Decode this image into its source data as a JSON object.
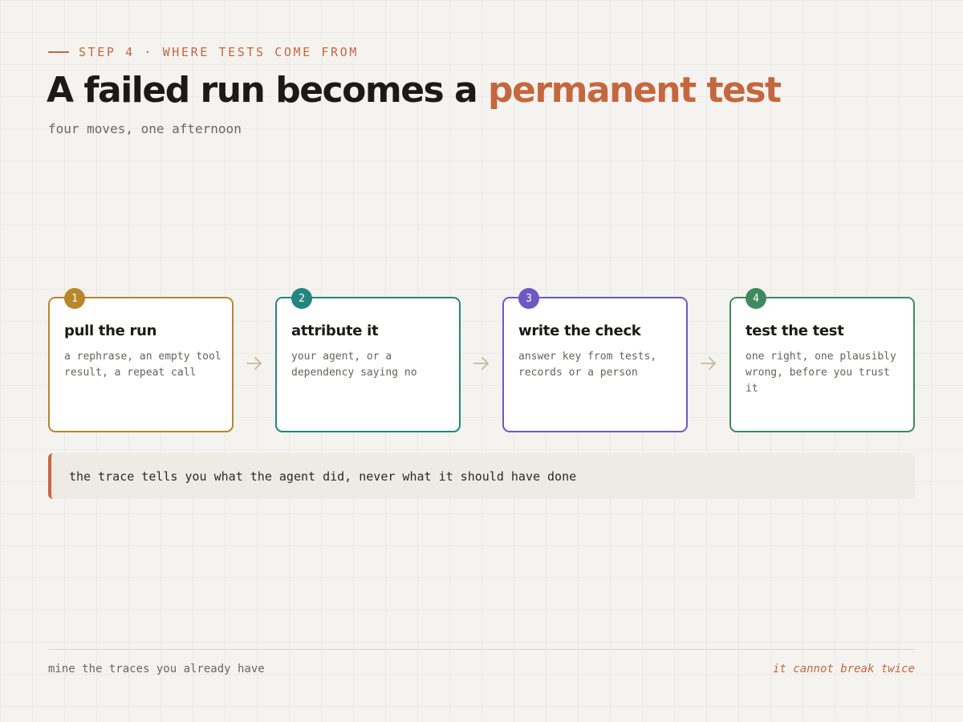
{
  "eyebrow": "STEP 4 · WHERE TESTS COME FROM",
  "title": {
    "main": "A failed run becomes a ",
    "accent": "permanent test"
  },
  "subtitle": "four moves, one afternoon",
  "colors": {
    "accent": "#c4673f",
    "step1": "#b8862b",
    "step2": "#23857f",
    "step3": "#6e58c2",
    "step4": "#3e8a5e"
  },
  "steps": [
    {
      "number": "1",
      "title": "pull the run",
      "description": "a rephrase, an empty tool\nresult, a repeat call"
    },
    {
      "number": "2",
      "title": "attribute it",
      "description": "your agent, or a dependency saying no"
    },
    {
      "number": "3",
      "title": "write the check",
      "description": "answer key from tests, records or a person"
    },
    {
      "number": "4",
      "title": "test the test",
      "description": "one right, one plausibly\nwrong, before you trust it"
    }
  ],
  "arrow_icon": "arrow-right-icon",
  "callout": "the trace tells you what the agent did, never what it should have done",
  "footer": {
    "left": "mine the traces you already have",
    "right": "it cannot break twice"
  }
}
